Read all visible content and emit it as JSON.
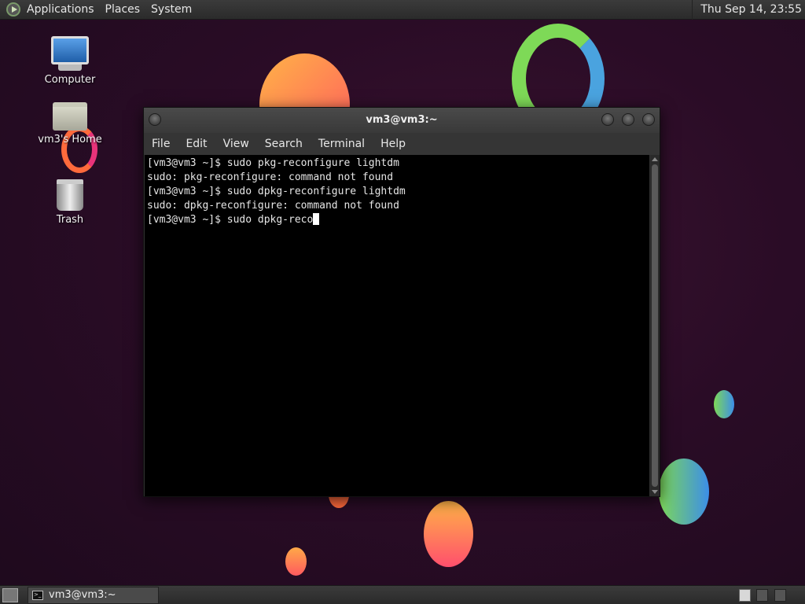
{
  "top_panel": {
    "menus": [
      "Applications",
      "Places",
      "System"
    ],
    "clock": "Thu Sep 14, 23:55"
  },
  "desktop_icons": [
    {
      "label": "Computer",
      "icon": "computer-icon"
    },
    {
      "label": "vm3's Home",
      "icon": "home-folder-icon"
    },
    {
      "label": "Trash",
      "icon": "trash-icon"
    }
  ],
  "window": {
    "title": "vm3@vm3:~",
    "menu": [
      "File",
      "Edit",
      "View",
      "Search",
      "Terminal",
      "Help"
    ],
    "lines": [
      "[vm3@vm3 ~]$ sudo pkg-reconfigure lightdm",
      "sudo: pkg-reconfigure: command not found",
      "[vm3@vm3 ~]$ sudo dpkg-reconfigure lightdm",
      "sudo: dpkg-reconfigure: command not found"
    ],
    "current_prompt": "[vm3@vm3 ~]$ sudo dpkg-reco"
  },
  "bottom_panel": {
    "task_label": "vm3@vm3:~"
  }
}
